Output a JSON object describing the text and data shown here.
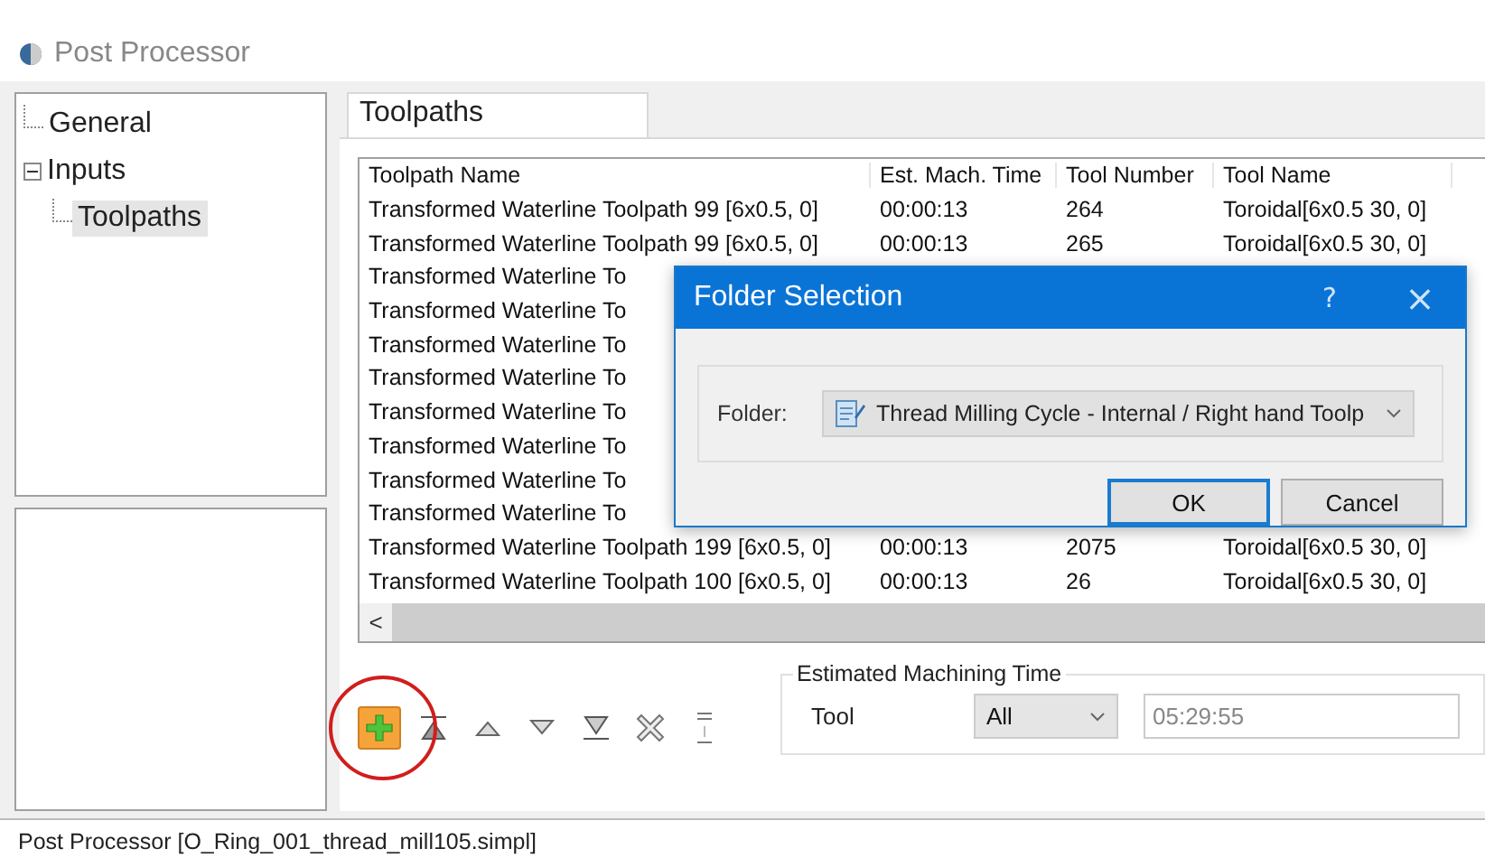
{
  "window": {
    "title": "Post Processor"
  },
  "tree": [
    {
      "label": "General",
      "selected": false
    },
    {
      "label": "Inputs",
      "selected": false,
      "expanded": true,
      "children": [
        {
          "label": "Toolpaths",
          "selected": true
        }
      ]
    }
  ],
  "tabs": [
    {
      "label": "Toolpaths",
      "selected": true
    }
  ],
  "table": {
    "columns": [
      "Toolpath Name",
      "Est. Mach. Time",
      "Tool Number",
      "Tool Name"
    ],
    "rows": [
      {
        "cells": [
          "Transformed Waterline Toolpath 99 [6x0.5, 0]",
          "00:00:13",
          "264",
          "Toroidal[6x0.5 30, 0]"
        ]
      },
      {
        "cells": [
          "Transformed Waterline Toolpath 99 [6x0.5, 0]",
          "00:00:13",
          "265",
          "Toroidal[6x0.5 30, 0]"
        ]
      },
      {
        "cells": [
          "Transformed Waterline To"
        ]
      },
      {
        "cells": [
          "Transformed Waterline To"
        ]
      },
      {
        "cells": [
          "Transformed Waterline To"
        ]
      },
      {
        "cells": [
          "Transformed Waterline To"
        ]
      },
      {
        "cells": [
          "Transformed Waterline To"
        ]
      },
      {
        "cells": [
          "Transformed Waterline To"
        ]
      },
      {
        "cells": [
          "Transformed Waterline To"
        ]
      },
      {
        "cells": [
          "Transformed Waterline To"
        ]
      },
      {
        "cells": [
          "Transformed Waterline Toolpath 199 [6x0.5, 0]",
          "00:00:13",
          "2075",
          "Toroidal[6x0.5 30, 0]"
        ]
      },
      {
        "cells": [
          "Transformed Waterline Toolpath 100 [6x0.5, 0]",
          "00:00:13",
          "26",
          "Toroidal[6x0.5 30, 0]"
        ]
      }
    ],
    "scroll_left": "<"
  },
  "toolbar": [
    {
      "kind": "add",
      "highlighted": true
    },
    {
      "kind": "top",
      "highlighted": false
    },
    {
      "kind": "up",
      "highlighted": false
    },
    {
      "kind": "down",
      "highlighted": false
    },
    {
      "kind": "bottom",
      "highlighted": false
    },
    {
      "kind": "delete",
      "highlighted": false
    },
    {
      "kind": "export",
      "highlighted": false
    }
  ],
  "machining_time": {
    "title": "Estimated Machining Time",
    "label": "Tool",
    "select": "All",
    "value": "05:29:55"
  },
  "dialog": {
    "title": "Folder Selection",
    "help": "?",
    "close": "×",
    "folder_label": "Folder:",
    "folder_value": "Thread Milling Cycle - Internal / Right hand Toolp",
    "buttons": [
      {
        "label": "OK",
        "default": true
      },
      {
        "label": "Cancel",
        "default": false
      }
    ]
  },
  "status_bar": "Post Processor [O_Ring_001_thread_mill105.simpl]"
}
